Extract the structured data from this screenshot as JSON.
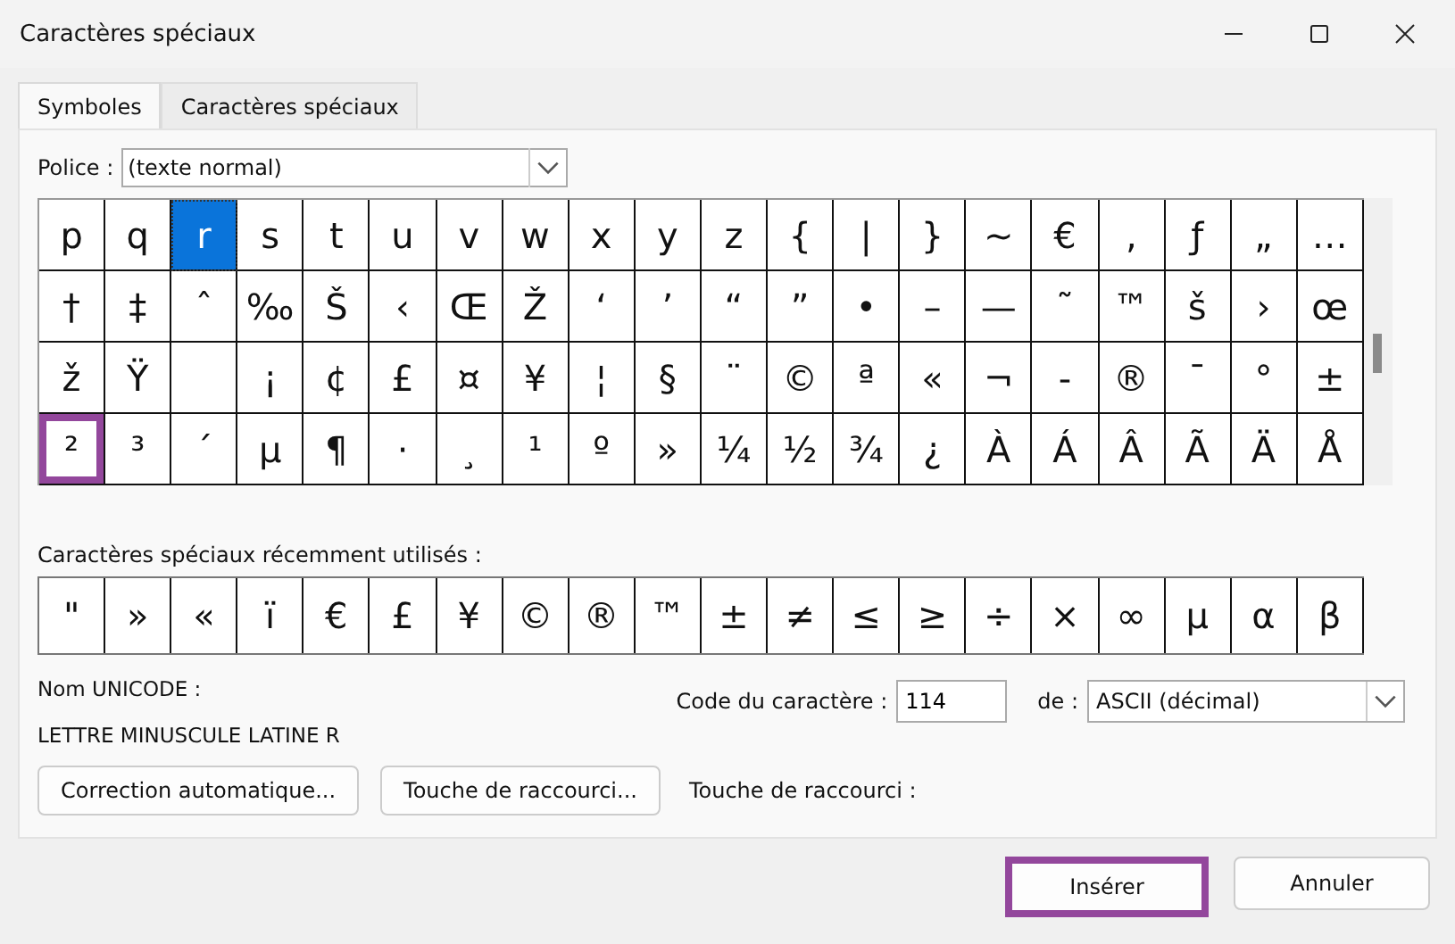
{
  "window": {
    "title": "Caractères spéciaux"
  },
  "tabs": [
    {
      "label": "Symboles",
      "selected": true
    },
    {
      "label": "Caractères spéciaux",
      "selected": false
    }
  ],
  "font_field": {
    "label": "Police :",
    "value": "(texte normal)"
  },
  "grid": [
    [
      {
        "char": "p",
        "selected": false,
        "highlighted": false
      },
      {
        "char": "q",
        "selected": false,
        "highlighted": false
      },
      {
        "char": "r",
        "selected": true,
        "highlighted": false
      },
      {
        "char": "s",
        "selected": false,
        "highlighted": false
      },
      {
        "char": "t",
        "selected": false,
        "highlighted": false
      },
      {
        "char": "u",
        "selected": false,
        "highlighted": false
      },
      {
        "char": "v",
        "selected": false,
        "highlighted": false
      },
      {
        "char": "w",
        "selected": false,
        "highlighted": false
      },
      {
        "char": "x",
        "selected": false,
        "highlighted": false
      },
      {
        "char": "y",
        "selected": false,
        "highlighted": false
      },
      {
        "char": "z",
        "selected": false,
        "highlighted": false
      },
      {
        "char": "{",
        "selected": false,
        "highlighted": false
      },
      {
        "char": "|",
        "selected": false,
        "highlighted": false
      },
      {
        "char": "}",
        "selected": false,
        "highlighted": false
      },
      {
        "char": "~",
        "selected": false,
        "highlighted": false
      },
      {
        "char": "€",
        "selected": false,
        "highlighted": false
      },
      {
        "char": "‚",
        "selected": false,
        "highlighted": false
      },
      {
        "char": "ƒ",
        "selected": false,
        "highlighted": false
      },
      {
        "char": "„",
        "selected": false,
        "highlighted": false
      },
      {
        "char": "…",
        "selected": false,
        "highlighted": false
      }
    ],
    [
      {
        "char": "†",
        "selected": false,
        "highlighted": false
      },
      {
        "char": "‡",
        "selected": false,
        "highlighted": false
      },
      {
        "char": "ˆ",
        "selected": false,
        "highlighted": false
      },
      {
        "char": "‰",
        "selected": false,
        "highlighted": false
      },
      {
        "char": "Š",
        "selected": false,
        "highlighted": false
      },
      {
        "char": "‹",
        "selected": false,
        "highlighted": false
      },
      {
        "char": "Œ",
        "selected": false,
        "highlighted": false
      },
      {
        "char": "Ž",
        "selected": false,
        "highlighted": false
      },
      {
        "char": "‘",
        "selected": false,
        "highlighted": false
      },
      {
        "char": "’",
        "selected": false,
        "highlighted": false
      },
      {
        "char": "“",
        "selected": false,
        "highlighted": false
      },
      {
        "char": "”",
        "selected": false,
        "highlighted": false
      },
      {
        "char": "•",
        "selected": false,
        "highlighted": false
      },
      {
        "char": "–",
        "selected": false,
        "highlighted": false
      },
      {
        "char": "—",
        "selected": false,
        "highlighted": false
      },
      {
        "char": "˜",
        "selected": false,
        "highlighted": false
      },
      {
        "char": "™",
        "selected": false,
        "highlighted": false
      },
      {
        "char": "š",
        "selected": false,
        "highlighted": false
      },
      {
        "char": "›",
        "selected": false,
        "highlighted": false
      },
      {
        "char": "œ",
        "selected": false,
        "highlighted": false
      }
    ],
    [
      {
        "char": "ž",
        "selected": false,
        "highlighted": false
      },
      {
        "char": "Ÿ",
        "selected": false,
        "highlighted": false
      },
      {
        "selected": false,
        "highlighted": false
      },
      {
        "char": "¡",
        "selected": false,
        "highlighted": false
      },
      {
        "char": "¢",
        "selected": false,
        "highlighted": false
      },
      {
        "char": "£",
        "selected": false,
        "highlighted": false
      },
      {
        "char": "¤",
        "selected": false,
        "highlighted": false
      },
      {
        "char": "¥",
        "selected": false,
        "highlighted": false
      },
      {
        "char": "¦",
        "selected": false,
        "highlighted": false
      },
      {
        "char": "§",
        "selected": false,
        "highlighted": false
      },
      {
        "char": "¨",
        "selected": false,
        "highlighted": false
      },
      {
        "char": "©",
        "selected": false,
        "highlighted": false
      },
      {
        "char": "ª",
        "selected": false,
        "highlighted": false
      },
      {
        "char": "«",
        "selected": false,
        "highlighted": false
      },
      {
        "char": "¬",
        "selected": false,
        "highlighted": false
      },
      {
        "char": "-",
        "selected": false,
        "highlighted": false
      },
      {
        "char": "®",
        "selected": false,
        "highlighted": false
      },
      {
        "char": "¯",
        "selected": false,
        "highlighted": false
      },
      {
        "char": "°",
        "selected": false,
        "highlighted": false
      },
      {
        "char": "±",
        "selected": false,
        "highlighted": false
      }
    ],
    [
      {
        "char": "²",
        "selected": false,
        "highlighted": true
      },
      {
        "char": "³",
        "selected": false,
        "highlighted": false
      },
      {
        "char": "´",
        "selected": false,
        "highlighted": false
      },
      {
        "char": "µ",
        "selected": false,
        "highlighted": false
      },
      {
        "char": "¶",
        "selected": false,
        "highlighted": false
      },
      {
        "char": "·",
        "selected": false,
        "highlighted": false
      },
      {
        "char": "¸",
        "selected": false,
        "highlighted": false
      },
      {
        "char": "¹",
        "selected": false,
        "highlighted": false
      },
      {
        "char": "º",
        "selected": false,
        "highlighted": false
      },
      {
        "char": "»",
        "selected": false,
        "highlighted": false
      },
      {
        "char": "¼",
        "selected": false,
        "highlighted": false
      },
      {
        "char": "½",
        "selected": false,
        "highlighted": false
      },
      {
        "char": "¾",
        "selected": false,
        "highlighted": false
      },
      {
        "char": "¿",
        "selected": false,
        "highlighted": false
      },
      {
        "char": "À",
        "selected": false,
        "highlighted": false
      },
      {
        "char": "Á",
        "selected": false,
        "highlighted": false
      },
      {
        "char": "Â",
        "selected": false,
        "highlighted": false
      },
      {
        "char": "Ã",
        "selected": false,
        "highlighted": false
      },
      {
        "char": "Ä",
        "selected": false,
        "highlighted": false
      },
      {
        "char": "Å",
        "selected": false,
        "highlighted": false
      }
    ]
  ],
  "recent": {
    "label": "Caractères spéciaux récemment utilisés :",
    "chars": [
      "\"",
      "»",
      "«",
      "ï",
      "€",
      "£",
      "¥",
      "©",
      "®",
      "™",
      "±",
      "≠",
      "≤",
      "≥",
      "÷",
      "×",
      "∞",
      "µ",
      "α",
      "β"
    ]
  },
  "unicode": {
    "label": "Nom UNICODE :",
    "value": "LETTRE MINUSCULE LATINE R"
  },
  "code": {
    "label": "Code du caractère :",
    "value": "114",
    "from_label": "de :",
    "from_value": "ASCII (décimal)"
  },
  "actions": [
    "Correction automatique...",
    "Touche de raccourci..."
  ],
  "shortcut_label": "Touche de raccourci :",
  "buttons": [
    {
      "label": "Insérer",
      "highlighted": true
    },
    {
      "label": "Annuler",
      "highlighted": false
    }
  ]
}
